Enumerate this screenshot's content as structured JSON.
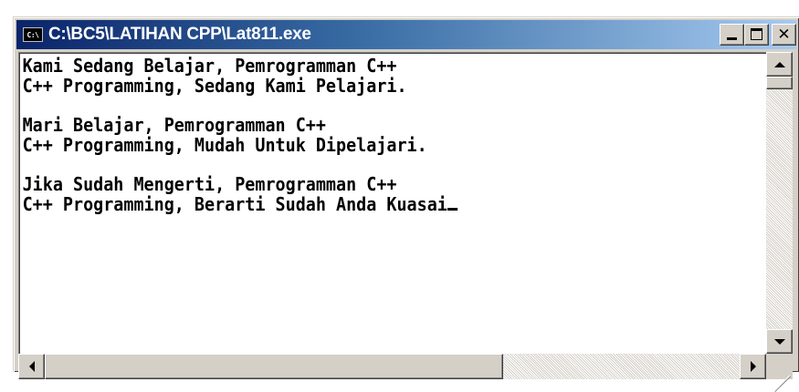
{
  "window": {
    "title": "C:\\BC5\\LATIHAN CPP\\Lat811.exe",
    "icon": "console-app-icon",
    "icon_text": "C:\\",
    "controls": {
      "minimize": "minimize-icon",
      "maximize": "maximize-icon",
      "close": "close-icon"
    }
  },
  "console": {
    "lines": [
      "Kami Sedang Belajar, Pemrogramman C++",
      "C++ Programming, Sedang Kami Pelajari.",
      "",
      "Mari Belajar, Pemrogramman C++",
      "C++ Programming, Mudah Untuk Dipelajari.",
      "",
      "Jika Sudah Mengerti, Pemrogramman C++",
      "C++ Programming, Berarti Sudah Anda Kuasai"
    ]
  },
  "colors": {
    "title_start": "#0a246a",
    "title_end": "#a6caf0",
    "console_bg": "#ffffff",
    "console_fg": "#000000",
    "chrome": "#d4d0c8"
  }
}
